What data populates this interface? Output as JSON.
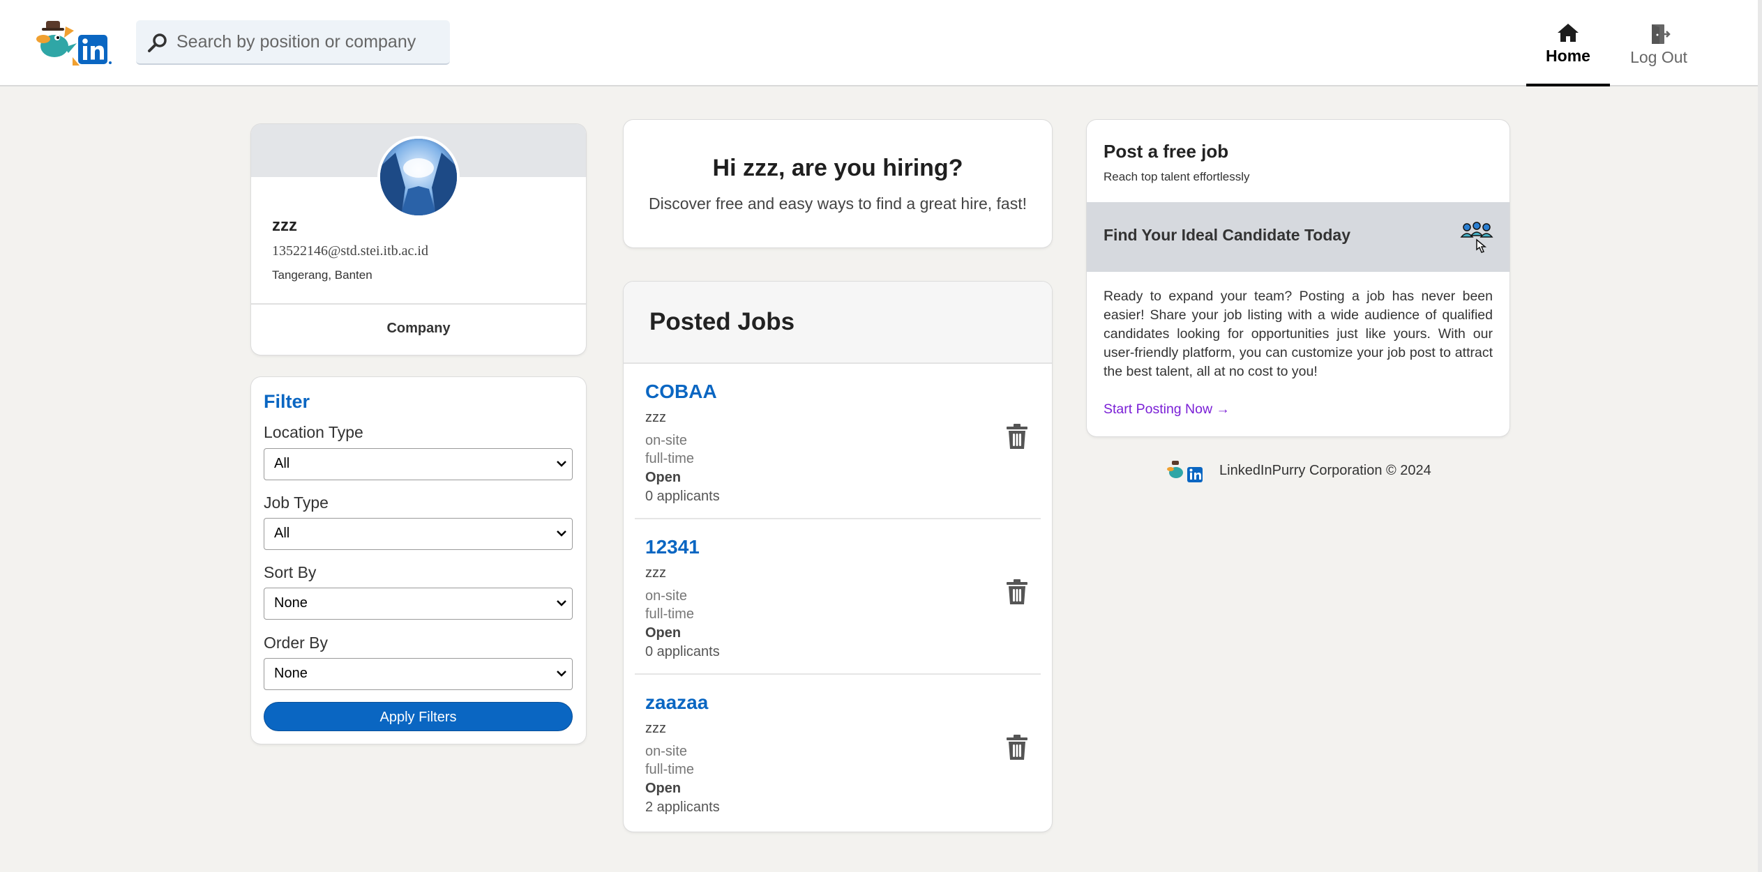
{
  "header": {
    "search_placeholder": "Search by position or company",
    "nav": [
      {
        "label": "Home",
        "icon": "home-icon",
        "active": true
      },
      {
        "label": "Log Out",
        "icon": "logout-icon",
        "active": false
      }
    ]
  },
  "profile": {
    "name": "zzz",
    "email": "13522146@std.stei.itb.ac.id",
    "location": "Tangerang, Banten",
    "role": "Company"
  },
  "filter": {
    "title": "Filter",
    "fields": [
      {
        "label": "Location Type",
        "value": "All"
      },
      {
        "label": "Job Type",
        "value": "All"
      },
      {
        "label": "Sort By",
        "value": "None"
      },
      {
        "label": "Order By",
        "value": "None"
      }
    ],
    "apply_label": "Apply Filters"
  },
  "hiring": {
    "title": "Hi zzz, are you hiring?",
    "subtitle": "Discover free and easy ways to find a great hire, fast!"
  },
  "jobs": {
    "title": "Posted Jobs",
    "items": [
      {
        "title": "COBAA",
        "company": "zzz",
        "location_type": "on-site",
        "job_type": "full-time",
        "status": "Open",
        "applicants": "0 applicants"
      },
      {
        "title": "12341",
        "company": "zzz",
        "location_type": "on-site",
        "job_type": "full-time",
        "status": "Open",
        "applicants": "0 applicants"
      },
      {
        "title": "zaazaa",
        "company": "zzz",
        "location_type": "on-site",
        "job_type": "full-time",
        "status": "Open",
        "applicants": "2 applicants"
      }
    ]
  },
  "post": {
    "title": "Post a free job",
    "subtitle": "Reach top talent effortlessly",
    "band_text": "Find Your Ideal Candidate Today",
    "description": "Ready to expand your team? Posting a job has never been easier! Share your job listing with a wide audience of qualified candidates looking for opportunities just like yours. With our user-friendly platform, you can customize your job post to attract the best talent, all at no cost to you!",
    "link_label": "Start Posting Now →"
  },
  "footer": {
    "text": "LinkedInPurry Corporation © 2024"
  },
  "colors": {
    "brand_blue": "#0a66c2",
    "background": "#f3f2ef",
    "link_purple": "#7a1fd6"
  }
}
